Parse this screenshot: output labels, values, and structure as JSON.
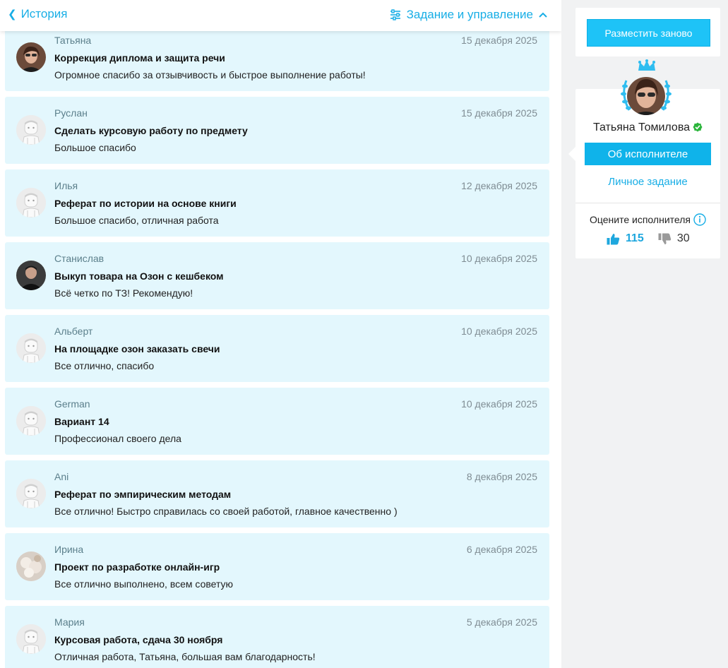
{
  "header": {
    "back_label": "История",
    "manage_label": "Задание и управление"
  },
  "reviews": [
    {
      "name": "Татьяна",
      "date": "15 декабря 2025",
      "title": "Коррекция диплома и защита речи",
      "text": "Огромное спасибо за отзывчивость и быстрое выполнение работы!",
      "avatar": "photo-woman"
    },
    {
      "name": "Руслан",
      "date": "15 декабря 2025",
      "title": "Сделать курсовую работу по предмету",
      "text": "Большое спасибо",
      "avatar": "default"
    },
    {
      "name": "Илья",
      "date": "12 декабря 2025",
      "title": "Реферат по истории на основе книги",
      "text": "Большое спасибо, отличная работа",
      "avatar": "default"
    },
    {
      "name": "Станислав",
      "date": "10 декабря 2025",
      "title": "Выкуп товара на Озон с кешбеком",
      "text": "Всё четко по ТЗ! Рекомендую!",
      "avatar": "photo-man"
    },
    {
      "name": "Альберт",
      "date": "10 декабря 2025",
      "title": "На площадке озон заказать свечи",
      "text": "Все отлично, спасибо",
      "avatar": "default"
    },
    {
      "name": "German",
      "date": "10 декабря 2025",
      "title": "Вариант 14",
      "text": "Профессионал своего дела",
      "avatar": "default"
    },
    {
      "name": "Ani",
      "date": "8 декабря 2025",
      "title": "Реферат по эмпирическим методам",
      "text": "Все отлично! Быстро справилась со своей работой, главное качественно )",
      "avatar": "default"
    },
    {
      "name": "Ирина",
      "date": "6 декабря 2025",
      "title": "Проект по разработке онлайн-игр",
      "text": "Все отлично выполнено, всем советую",
      "avatar": "photo-flowers"
    },
    {
      "name": "Мария",
      "date": "5 декабря 2025",
      "title": "Курсовая работа, сдача 30 ноября",
      "text": "Отличная работа, Татьяна, большая вам благодарность!",
      "avatar": "default"
    }
  ],
  "sidebar": {
    "repost_label": "Разместить заново",
    "performer_name": "Татьяна Томилова",
    "about_label": "Об исполнителе",
    "personal_task_label": "Личное задание",
    "rate_label": "Оцените исполнителя",
    "likes": "115",
    "dislikes": "30"
  },
  "colors": {
    "accent": "#18aee6",
    "card_bg": "#e3f7fd",
    "button": "#1ec3f7"
  }
}
